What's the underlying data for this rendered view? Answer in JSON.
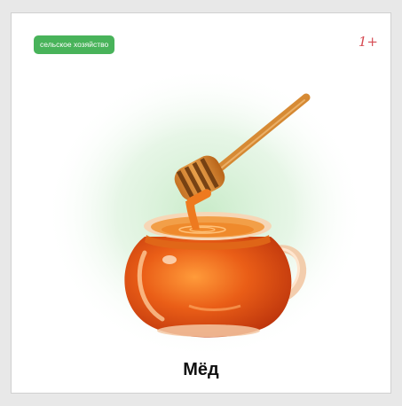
{
  "card": {
    "category_badge": "сельское хозяйство",
    "age_rating": "1+",
    "title": "Мёд",
    "illustration_icon": "honey-pot-with-dipper-icon"
  },
  "colors": {
    "badge": "#48b35a",
    "age_rating": "#d64a52",
    "glow": "#c6eac6",
    "honey": "#e9601a",
    "dipper_wood": "#d98a33"
  }
}
